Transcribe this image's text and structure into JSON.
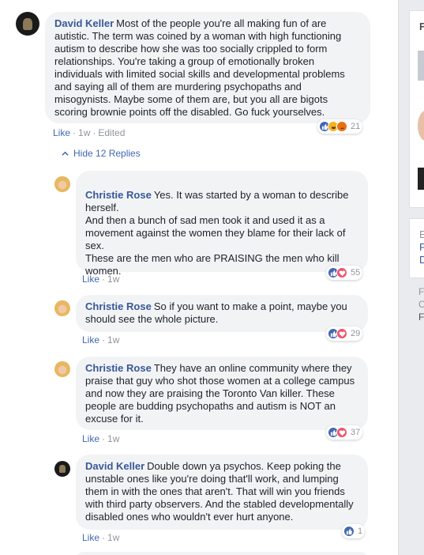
{
  "main_comment": {
    "author": "David Keller",
    "text": "Most of the people you're all making fun of are autistic. The term was coined by a woman with high functioning autism to describe how she was too socially crippled to form relationships. You're taking a group of emotionally broken individuals with limited social skills and developmental problems and saying all of them are murdering psychopaths and misogynists. Maybe some of them are, but you all are bigots scoring brownie points off the disabled. Go fuck yourselves.",
    "like_label": "Like",
    "time": "1w",
    "edited": "Edited",
    "reactions": [
      "like-icon",
      "haha-icon",
      "angry-icon"
    ],
    "reaction_count": "21"
  },
  "hide_replies_label": "Hide 12 Replies",
  "replies": [
    {
      "author": "Christie Rose",
      "text": "Yes. It was started by a woman to describe herself.\nAnd then a bunch of sad men took it and used it as a movement against the women they blame for their lack of sex.\nThese are the men who are PRAISING the men who kill women.",
      "like_label": "Like",
      "time": "1w",
      "reactions": [
        "like-icon",
        "love-icon"
      ],
      "reaction_count": "55"
    },
    {
      "author": "Christie Rose",
      "text": "So if you want to make a point, maybe you should see the whole picture.",
      "like_label": "Like",
      "time": "1w",
      "reactions": [
        "like-icon",
        "love-icon"
      ],
      "reaction_count": "29"
    },
    {
      "author": "Christie Rose",
      "text": "They have an online community where they praise that guy who shot those women at a college campus and now they are praising the Toronto Van killer. These people are budding psychopaths and autism is NOT an excuse for it.",
      "like_label": "Like",
      "time": "1w",
      "reactions": [
        "like-icon",
        "love-icon"
      ],
      "reaction_count": "37"
    },
    {
      "author": "David Keller",
      "text": "Double down ya psychos. Keep poking the unstable ones like you're doing that'll work, and lumping them in with the ones that aren't. That will win you friends with third party observers. And the stabled developmentally disabled ones who wouldn't ever hurt anyone.",
      "like_label": "Like",
      "time": "1w",
      "reactions": [
        "like-icon"
      ],
      "reaction_count": "1"
    }
  ],
  "right_rail": {
    "box1_letter": "F",
    "box2_lines": [
      "E",
      "F",
      "D"
    ],
    "box3_lines": [
      "F",
      "C",
      "F"
    ]
  }
}
